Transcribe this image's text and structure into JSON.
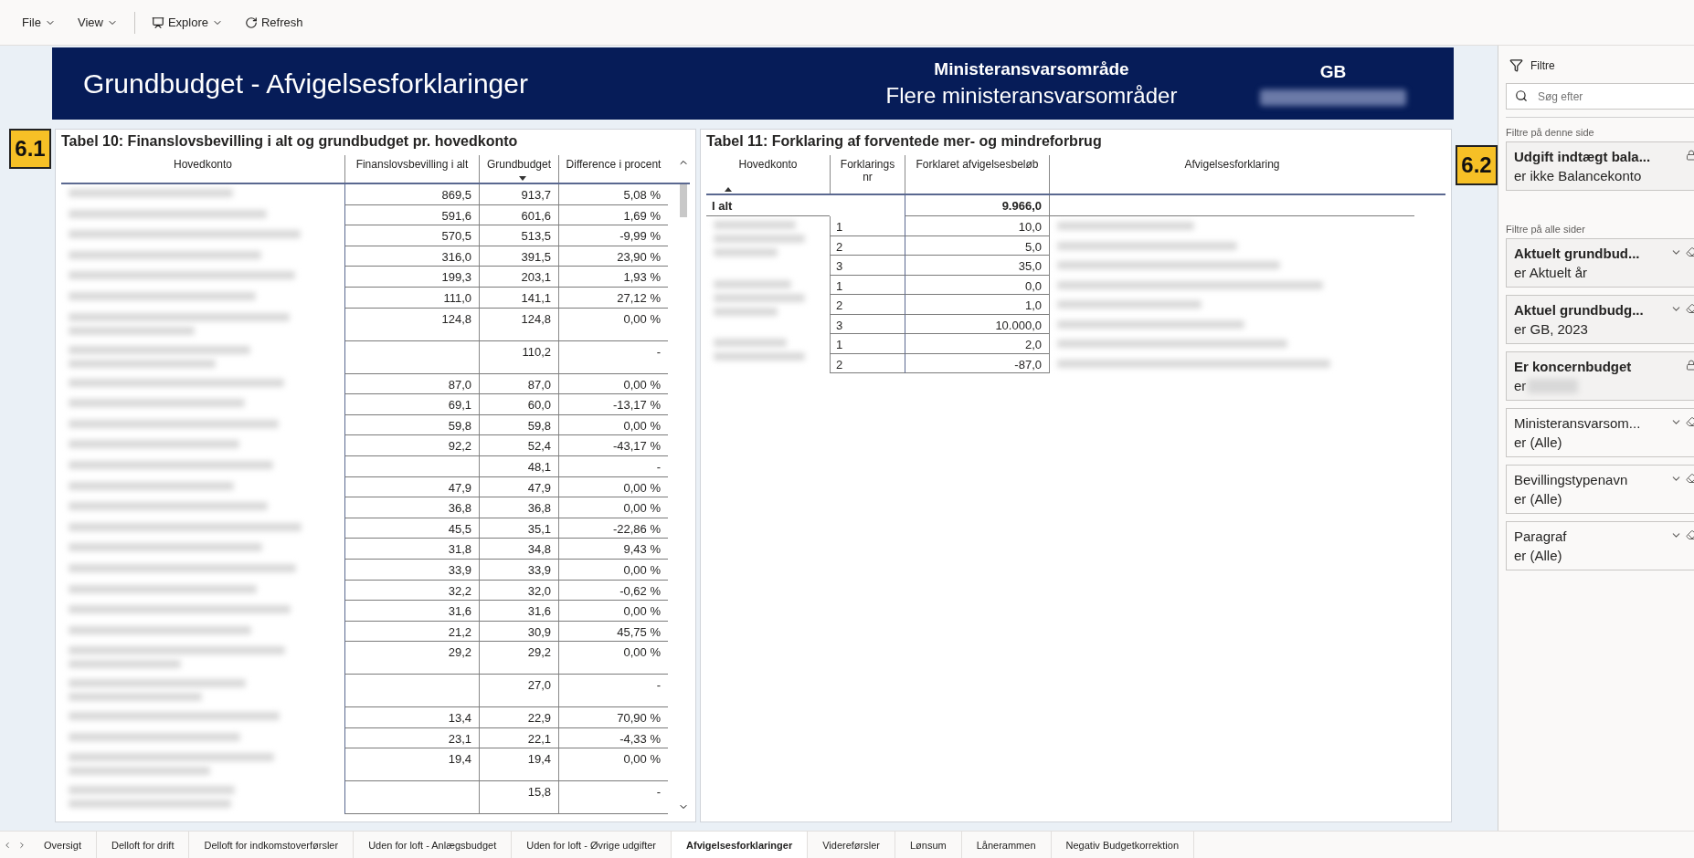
{
  "toolbar": {
    "items": [
      {
        "label": "File",
        "kind": "menu"
      },
      {
        "label": "View",
        "kind": "menu"
      },
      {
        "label": "Explore",
        "kind": "explore"
      },
      {
        "label": "Refresh",
        "kind": "refresh"
      }
    ]
  },
  "banner": {
    "title": "Grundbudget - Afvigelsesforklaringer",
    "scope_label": "Ministeransvarsområde",
    "scope_value": "Flere ministeransvarsområder",
    "budget_label": "GB"
  },
  "table_10": {
    "badge": "6.1",
    "title": "Tabel 10: Finanslovsbevilling i alt og grundbudget pr. hovedkonto",
    "columns": [
      {
        "label": "Hovedkonto",
        "sorted": false
      },
      {
        "label": "Finanslovsbevilling i alt",
        "sorted": false
      },
      {
        "label": "Grundbudget",
        "sorted": true,
        "descending": true
      },
      {
        "label": "Difference i procent",
        "sorted": false
      }
    ],
    "rows": [
      {
        "kind": "single",
        "finanslov": "869,5",
        "grundbudget": "913,7",
        "difference": "5,08 %"
      },
      {
        "kind": "single",
        "finanslov": "591,6",
        "grundbudget": "601,6",
        "difference": "1,69 %"
      },
      {
        "kind": "single",
        "finanslov": "570,5",
        "grundbudget": "513,5",
        "difference": "-9,99 %"
      },
      {
        "kind": "single",
        "finanslov": "316,0",
        "grundbudget": "391,5",
        "difference": "23,90 %"
      },
      {
        "kind": "single",
        "finanslov": "199,3",
        "grundbudget": "203,1",
        "difference": "1,93 %"
      },
      {
        "kind": "single",
        "finanslov": "111,0",
        "grundbudget": "141,1",
        "difference": "27,12 %"
      },
      {
        "kind": "double",
        "finanslov": "124,8",
        "grundbudget": "124,8",
        "difference": "0,00 %"
      },
      {
        "kind": "double",
        "grundbudget": "110,2",
        "difference": "-"
      },
      {
        "kind": "single",
        "finanslov": "87,0",
        "grundbudget": "87,0",
        "difference": "0,00 %"
      },
      {
        "kind": "single",
        "finanslov": "69,1",
        "grundbudget": "60,0",
        "difference": "-13,17 %"
      },
      {
        "kind": "single",
        "finanslov": "59,8",
        "grundbudget": "59,8",
        "difference": "0,00 %"
      },
      {
        "kind": "single",
        "finanslov": "92,2",
        "grundbudget": "52,4",
        "difference": "-43,17 %"
      },
      {
        "kind": "single",
        "grundbudget": "48,1",
        "difference": "-"
      },
      {
        "kind": "single",
        "finanslov": "47,9",
        "grundbudget": "47,9",
        "difference": "0,00 %"
      },
      {
        "kind": "single",
        "finanslov": "36,8",
        "grundbudget": "36,8",
        "difference": "0,00 %"
      },
      {
        "kind": "single",
        "finanslov": "45,5",
        "grundbudget": "35,1",
        "difference": "-22,86 %"
      },
      {
        "kind": "single",
        "finanslov": "31,8",
        "grundbudget": "34,8",
        "difference": "9,43 %"
      },
      {
        "kind": "single",
        "finanslov": "33,9",
        "grundbudget": "33,9",
        "difference": "0,00 %"
      },
      {
        "kind": "single",
        "finanslov": "32,2",
        "grundbudget": "32,0",
        "difference": "-0,62 %"
      },
      {
        "kind": "single",
        "finanslov": "31,6",
        "grundbudget": "31,6",
        "difference": "0,00 %"
      },
      {
        "kind": "single",
        "finanslov": "21,2",
        "grundbudget": "30,9",
        "difference": "45,75 %"
      },
      {
        "kind": "double",
        "finanslov": "29,2",
        "grundbudget": "29,2",
        "difference": "0,00 %"
      },
      {
        "kind": "double",
        "grundbudget": "27,0",
        "difference": "-"
      },
      {
        "kind": "single",
        "finanslov": "13,4",
        "grundbudget": "22,9",
        "difference": "70,90 %"
      },
      {
        "kind": "single",
        "finanslov": "23,1",
        "grundbudget": "22,1",
        "difference": "-4,33 %"
      },
      {
        "kind": "double",
        "finanslov": "19,4",
        "grundbudget": "19,4",
        "difference": "0,00 %"
      },
      {
        "kind": "double",
        "grundbudget": "15,8",
        "difference": "-"
      }
    ]
  },
  "table_11": {
    "badge": "6.2",
    "title": "Tabel 11: Forklaring af forventede mer- og mindreforbrug",
    "columns": [
      {
        "label": "Hovedkonto",
        "sorted": true,
        "descending": false
      },
      {
        "label": "Forklarings nr",
        "sorted": false
      },
      {
        "label": "Forklaret afvigelsesbeløb",
        "sorted": false
      },
      {
        "label": "Afvigelsesforklaring",
        "sorted": false
      }
    ],
    "total": {
      "label": "I alt",
      "amount": "9.966,0"
    },
    "groups": [
      {
        "rows": [
          {
            "nr": "1",
            "amount": "10,0"
          },
          {
            "nr": "2",
            "amount": "5,0"
          },
          {
            "nr": "3",
            "amount": "35,0"
          }
        ]
      },
      {
        "rows": [
          {
            "nr": "1",
            "amount": "0,0"
          },
          {
            "nr": "2",
            "amount": "1,0"
          },
          {
            "nr": "3",
            "amount": "10.000,0"
          }
        ]
      },
      {
        "rows": [
          {
            "nr": "1",
            "amount": "2,0"
          },
          {
            "nr": "2",
            "amount": "-87,0"
          }
        ]
      }
    ]
  },
  "filters": {
    "title": "Filtre",
    "search": {
      "placeholder": "Søg efter"
    },
    "sections": [
      {
        "title": "Filtre på denne side",
        "cards": [
          {
            "name": "Udgift indtægt bala...",
            "value": "er ikke Balancekonto",
            "applied": true,
            "locked": true,
            "redacted": false
          }
        ]
      },
      {
        "title": "Filtre på alle sider",
        "cards": [
          {
            "name": "Aktuelt grundbud...",
            "value": "er Aktuelt år",
            "applied": true,
            "locked": false,
            "redacted": false
          },
          {
            "name": "Aktuel grundbudg...",
            "value": "er GB, 2023",
            "applied": true,
            "locked": false,
            "redacted": false
          },
          {
            "name": "Er koncernbudget",
            "value": "er",
            "applied": true,
            "locked": true,
            "redacted": true
          },
          {
            "name": "Ministeransvarsom...",
            "value": "er (Alle)",
            "applied": false,
            "locked": false,
            "redacted": false
          },
          {
            "name": "Bevillingstypenavn",
            "value": "er (Alle)",
            "applied": false,
            "locked": false,
            "redacted": false
          },
          {
            "name": "Paragraf",
            "value": "er (Alle)",
            "applied": false,
            "locked": false,
            "redacted": false
          }
        ]
      }
    ]
  },
  "page_tabs": [
    {
      "label": "Oversigt",
      "selected": false
    },
    {
      "label": "Delloft for drift",
      "selected": false
    },
    {
      "label": "Delloft for indkomstoverførsler",
      "selected": false
    },
    {
      "label": "Uden for loft - Anlægsbudget",
      "selected": false
    },
    {
      "label": "Uden for loft - Øvrige udgifter",
      "selected": false
    },
    {
      "label": "Afvigelsesforklaringer",
      "selected": true
    },
    {
      "label": "Videreførsler",
      "selected": false
    },
    {
      "label": "Lønsum",
      "selected": false
    },
    {
      "label": "Lånerammen",
      "selected": false
    },
    {
      "label": "Negativ Budgetkorrektion",
      "selected": false
    }
  ]
}
